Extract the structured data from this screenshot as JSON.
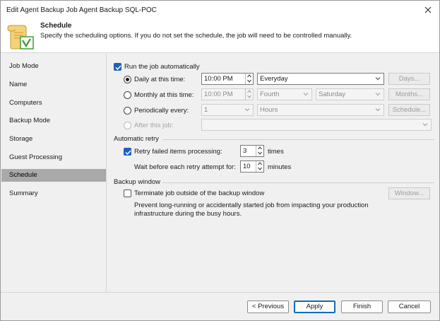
{
  "window": {
    "title": "Edit Agent Backup Job Agent Backup SQL-POC"
  },
  "header": {
    "title": "Schedule",
    "description": "Specify the scheduling options. If you do not set the schedule, the job will need to be controlled manually."
  },
  "sidebar": {
    "items": [
      {
        "label": "Job Mode"
      },
      {
        "label": "Name"
      },
      {
        "label": "Computers"
      },
      {
        "label": "Backup Mode"
      },
      {
        "label": "Storage"
      },
      {
        "label": "Guest Processing"
      },
      {
        "label": "Schedule",
        "active": true
      },
      {
        "label": "Summary"
      }
    ]
  },
  "schedule": {
    "run_auto_label": "Run the job automatically",
    "daily": {
      "label": "Daily at this time:",
      "time": "10:00 PM",
      "frequency": "Everyday",
      "button": "Days..."
    },
    "monthly": {
      "label": "Monthly at this time:",
      "time": "10:00 PM",
      "week": "Fourth",
      "day": "Saturday",
      "button": "Months..."
    },
    "periodic": {
      "label": "Periodically every:",
      "value": "1",
      "unit": "Hours",
      "button": "Schedule..."
    },
    "after": {
      "label": "After this job:",
      "value": ""
    }
  },
  "retry": {
    "section_title": "Automatic retry",
    "retry_label": "Retry failed items processing:",
    "retry_count": "3",
    "retry_unit": "times",
    "wait_label": "Wait before each retry attempt for:",
    "wait_value": "10",
    "wait_unit": "minutes"
  },
  "backup_window": {
    "section_title": "Backup window",
    "terminate_label": "Terminate job outside of the backup window",
    "button": "Window...",
    "help_line1": "Prevent long-running or accidentally started job from impacting your production",
    "help_line2": "infrastructure during the busy hours."
  },
  "footer": {
    "previous": "< Previous",
    "apply": "Apply",
    "finish": "Finish",
    "cancel": "Cancel"
  },
  "colors": {
    "accent": "#1f5fbf",
    "selected_nav": "#a9a9a9"
  }
}
